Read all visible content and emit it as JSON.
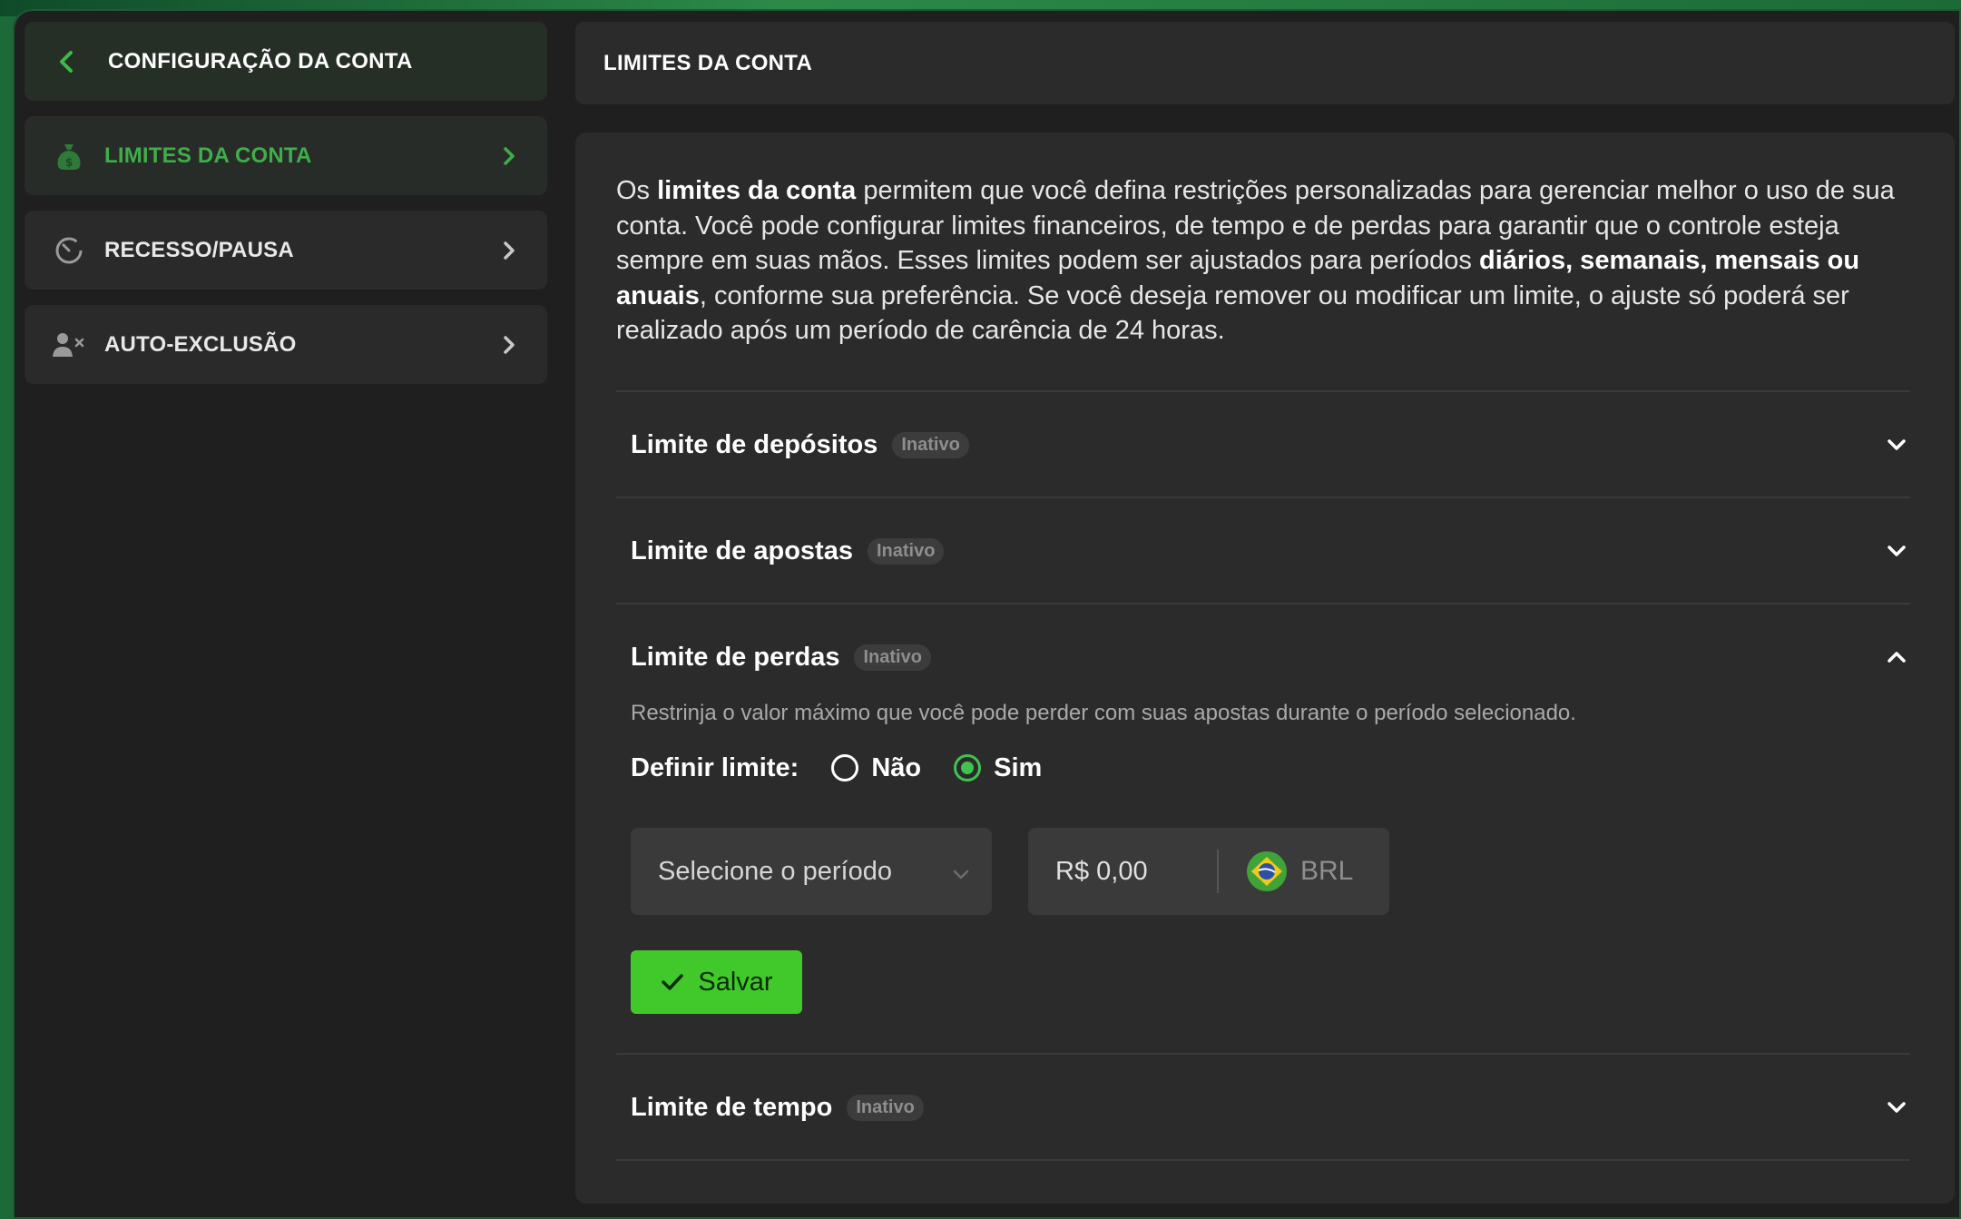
{
  "sidebar": {
    "header": "CONFIGURAÇÃO DA CONTA",
    "items": [
      {
        "label": "LIMITES DA CONTA",
        "icon": "money-bag-icon",
        "active": true
      },
      {
        "label": "RECESSO/PAUSA",
        "icon": "timer-icon",
        "active": false
      },
      {
        "label": "AUTO-EXCLUSÃO",
        "icon": "user-x-icon",
        "active": false
      }
    ]
  },
  "page": {
    "title": "LIMITES DA CONTA"
  },
  "intro": {
    "p1": "Os ",
    "b1": "limites da conta",
    "p2": " permitem que você defina restrições personalizadas para gerenciar melhor o uso de sua conta. Você pode configurar limites financeiros, de tempo e de perdas para garantir que o controle esteja sempre em suas mãos. Esses limites podem ser ajustados para períodos ",
    "b2": "diários, semanais, mensais ou anuais",
    "p3": ", conforme sua preferência. Se você deseja remover ou modificar um limite, o ajuste só poderá ser realizado após um período de carência de 24 horas."
  },
  "limits": [
    {
      "title": "Limite de depósitos",
      "status": "Inativo",
      "expanded": false
    },
    {
      "title": "Limite de apostas",
      "status": "Inativo",
      "expanded": false
    },
    {
      "title": "Limite de perdas",
      "status": "Inativo",
      "expanded": true
    },
    {
      "title": "Limite de tempo",
      "status": "Inativo",
      "expanded": false
    }
  ],
  "loss_limit": {
    "description": "Restrinja o valor máximo que você pode perder com suas apostas durante o período selecionado.",
    "define_label": "Definir limite:",
    "option_no": "Não",
    "option_yes": "Sim",
    "selected": "Sim",
    "period_placeholder": "Selecione o período",
    "amount": "R$ 0,00",
    "currency": "BRL",
    "save_label": "Salvar"
  },
  "colors": {
    "accent": "#41c92b",
    "active_text": "#3fae4a",
    "panel": "#2b2b2b",
    "background": "#1f1f1f"
  }
}
